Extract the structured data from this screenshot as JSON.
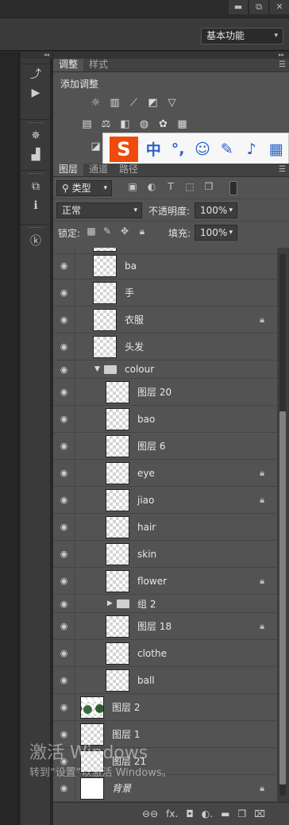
{
  "window": {
    "minimize": "▬",
    "restore": "⧉",
    "close": "✕"
  },
  "workspace": {
    "label": "基本功能"
  },
  "adjustments": {
    "tabs": [
      "调整",
      "样式"
    ],
    "title": "添加调整",
    "row1_icons": [
      "brightness-icon",
      "levels-icon",
      "curves-icon",
      "exposure-icon",
      "vibrance-icon"
    ],
    "row2_icons": [
      "color-balance-icon",
      "scales-icon",
      "black-white-icon",
      "photo-filter-icon",
      "channel-mixer-icon",
      "color-lookup-icon"
    ]
  },
  "ime": {
    "logo": "S",
    "items": [
      "中",
      "°,",
      "☺",
      "✎",
      "🎤",
      "▦"
    ]
  },
  "layers_panel": {
    "tabs": [
      "图层",
      "通道",
      "路径"
    ],
    "filter_label": "类型",
    "blend_mode": "正常",
    "opacity_label": "不透明度:",
    "opacity_value": "100%",
    "lock_label": "锁定:",
    "fill_label": "填充:",
    "fill_value": "100%"
  },
  "layers": [
    {
      "name": "ba",
      "indent": 1,
      "thumb": "transparent",
      "locked": false
    },
    {
      "name": "手",
      "indent": 1,
      "thumb": "transparent",
      "locked": false
    },
    {
      "name": "衣服",
      "indent": 1,
      "thumb": "transparent",
      "locked": true
    },
    {
      "name": "头发",
      "indent": 1,
      "thumb": "transparent",
      "locked": false
    },
    {
      "name": "colour",
      "indent": 1,
      "folder": true,
      "expanded": true
    },
    {
      "name": "图层 20",
      "indent": 2,
      "thumb": "transparent",
      "locked": false
    },
    {
      "name": "bao",
      "indent": 2,
      "thumb": "transparent",
      "locked": false
    },
    {
      "name": "图层 6",
      "indent": 2,
      "thumb": "transparent",
      "locked": false
    },
    {
      "name": "eye",
      "indent": 2,
      "thumb": "transparent",
      "locked": true
    },
    {
      "name": "jiao",
      "indent": 2,
      "thumb": "transparent",
      "locked": true
    },
    {
      "name": "hair",
      "indent": 2,
      "thumb": "transparent",
      "locked": false
    },
    {
      "name": "skin",
      "indent": 2,
      "thumb": "transparent",
      "locked": false
    },
    {
      "name": "flower",
      "indent": 2,
      "thumb": "transparent",
      "locked": true
    },
    {
      "name": "组 2",
      "indent": 2,
      "folder": true,
      "expanded": false
    },
    {
      "name": "图层 18",
      "indent": 2,
      "thumb": "transparent",
      "locked": true
    },
    {
      "name": "clothe",
      "indent": 2,
      "thumb": "transparent",
      "locked": false
    },
    {
      "name": "ball",
      "indent": 2,
      "thumb": "transparent",
      "locked": false
    },
    {
      "name": "图层 2",
      "indent": 0,
      "thumb": "plant",
      "locked": false
    },
    {
      "name": "图层 1",
      "indent": 0,
      "thumb": "transparent",
      "locked": false
    },
    {
      "name": "图层 21",
      "indent": 0,
      "thumb": "transparent",
      "locked": false
    },
    {
      "name": "背景",
      "indent": 0,
      "thumb": "solid",
      "locked": true
    }
  ],
  "footer_icons": [
    "link-icon",
    "fx-icon",
    "mask-icon",
    "adjustment-icon",
    "folder-icon",
    "new-layer-icon",
    "trash-icon"
  ],
  "footer_labels": [
    "⊖⊖",
    "fx.",
    "◘",
    "◐.",
    "▬",
    "❐",
    "🗑"
  ],
  "watermark": {
    "line1": "激活 Windows",
    "line2": "转到“设置”以激活 Windows。"
  }
}
